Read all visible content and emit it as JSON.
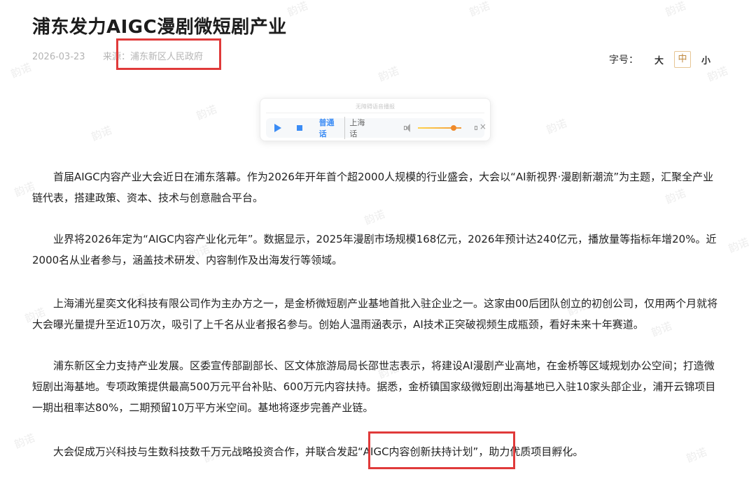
{
  "article": {
    "title": "浦东发力AIGC漫剧微短剧产业",
    "date": "2026-03-23",
    "source_label": "来源：",
    "source": "浦东新区人民政府"
  },
  "font_size": {
    "label": "字号：",
    "large": "大",
    "medium": "中",
    "small": "小",
    "selected": "中"
  },
  "audio_player": {
    "title": "无障碍语音播报",
    "lang_mandarin": "普通话",
    "lang_shanghainese": "上海话",
    "selected_lang": "普通话",
    "volume": 0.82
  },
  "paragraphs": [
    "首届AIGC内容产业大会近日在浦东落幕。作为2026年开年首个超2000人规模的行业盛会，大会以“AI新视界·漫剧新潮流”为主题，汇聚全产业链代表，搭建政策、资本、技术与创意融合平台。",
    "业界将2026年定为“AIGC内容产业化元年”。数据显示，2025年漫剧市场规模168亿元，2026年预计达240亿元，播放量等指标年增20%。近2000名从业者参与，涵盖技术研发、内容制作及出海发行等领域。",
    "上海浦光星奕文化科技有限公司作为主办方之一，是金桥微短剧产业基地首批入驻企业之一。这家由00后团队创立的初创公司，仅用两个月就将大会曝光量提升至近10万次，吸引了上千名从业者报名参与。创始人温雨涵表示，AI技术正突破视频生成瓶颈，看好未来十年赛道。",
    "浦东新区全力支持产业发展。区委宣传部副部长、区文体旅游局局长邵世志表示，将建设AI漫剧产业高地，在金桥等区域规划办公空间；打造微短剧出海基地。专项政策提供最高500万元平台补贴、600万元内容扶持。据悉，金桥镇国家级微短剧出海基地已入驻10家头部企业，浦开云锦项目一期出租率达80%，二期预留10万平方米空间。基地将逐步完善产业链。",
    "大会促成万兴科技与生数科技数千万元战略投资合作，并联合发起“AIGC内容创新扶持计划”，助力优质项目孵化。"
  ],
  "watermark": "韵诺"
}
